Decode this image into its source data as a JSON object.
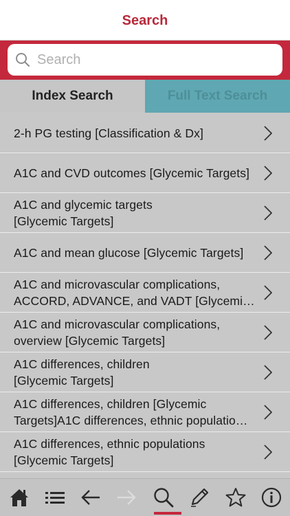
{
  "header": {
    "title": "Search"
  },
  "search": {
    "placeholder": "Search",
    "value": ""
  },
  "tabs": [
    {
      "label": "Index Search",
      "active": true
    },
    {
      "label": "Full Text Search",
      "active": false
    }
  ],
  "list": [
    {
      "lines": [
        "2-h PG testing [Classification & Dx]"
      ]
    },
    {
      "lines": [
        "A1C and CVD outcomes [Glycemic Targets]"
      ]
    },
    {
      "lines": [
        "A1C and glycemic targets",
        "[Glycemic Targets]"
      ]
    },
    {
      "lines": [
        "A1C and mean glucose [Glycemic Targets]"
      ]
    },
    {
      "lines": [
        "A1C and microvascular complications,",
        "ACCORD, ADVANCE, and VADT [Glycemic…"
      ]
    },
    {
      "lines": [
        "A1C and microvascular complications,",
        "overview [Glycemic Targets]"
      ]
    },
    {
      "lines": [
        "A1C differences, children",
        "[Glycemic Targets]"
      ]
    },
    {
      "lines": [
        "A1C differences, children [Glycemic",
        "Targets]A1C differences, ethnic populatio…"
      ]
    },
    {
      "lines": [
        "A1C differences, ethnic populations",
        "[Glycemic Targets]"
      ]
    }
  ],
  "toolbar": {
    "icons": [
      "home-icon",
      "list-icon",
      "back-arrow-icon",
      "forward-arrow-icon",
      "search-icon",
      "pencil-icon",
      "star-icon",
      "info-icon"
    ],
    "active": "search-icon"
  },
  "colors": {
    "brand": "#c4283c",
    "inactive_tab": "#5fa7b2",
    "list_bg": "#c8c8c8"
  }
}
